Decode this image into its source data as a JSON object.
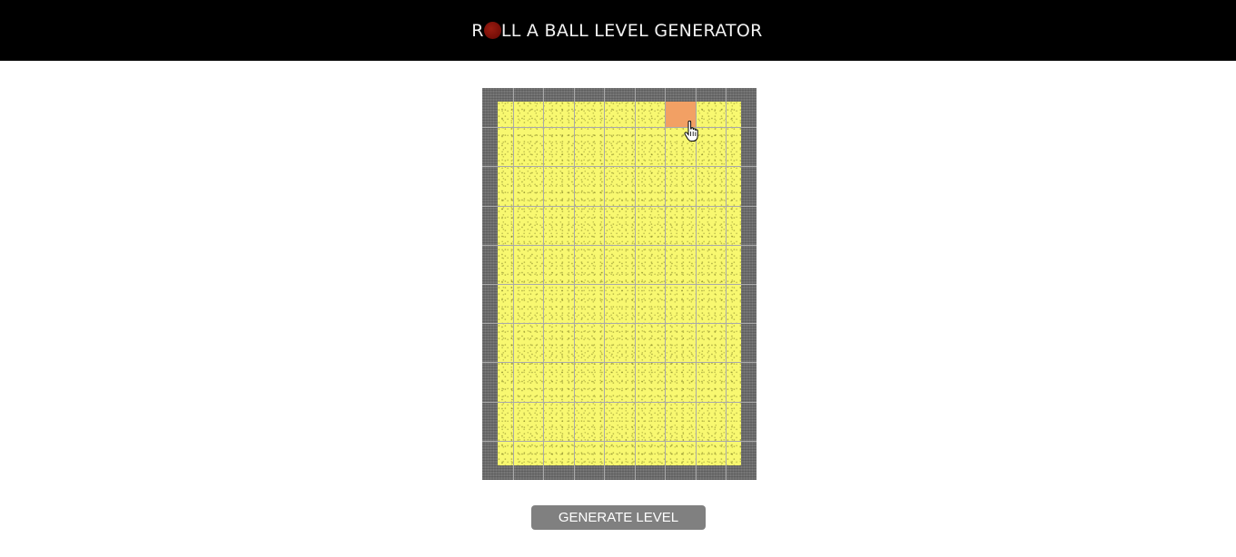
{
  "header": {
    "title_prefix": "R",
    "title_suffix": "LL A BALL LEVEL GENERATOR",
    "ball_color": "#8a140c",
    "background": "#000000"
  },
  "board": {
    "columns": 9,
    "rows": 10,
    "wall_color": "#6e6e6e",
    "floor_color": "#f8f870",
    "selected_color": "#f2a064",
    "selected_tile": {
      "row": 0,
      "col": 6
    }
  },
  "cursor": {
    "icon": "hand-pointer-icon"
  },
  "button": {
    "generate_label": "GENERATE LEVEL",
    "color": "#808080"
  }
}
